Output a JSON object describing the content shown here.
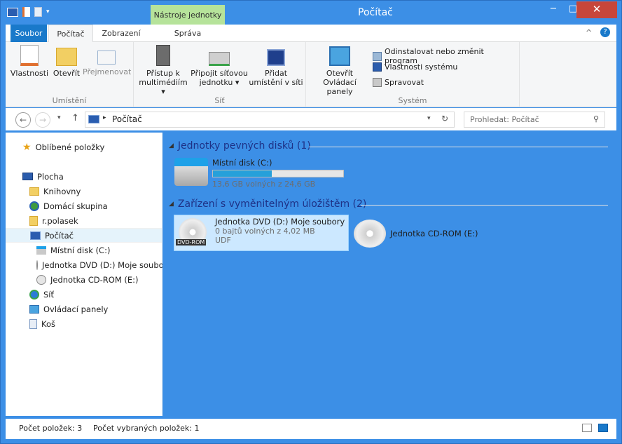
{
  "window": {
    "title": "Počítač",
    "contextual_tab": "Nástroje jednotky",
    "minimize": "−",
    "maximize": "□",
    "close": "✕"
  },
  "tabs": [
    {
      "label": "Soubor"
    },
    {
      "label": "Počítač"
    },
    {
      "label": "Zobrazení"
    },
    {
      "label": "Správa"
    }
  ],
  "ribbon": {
    "groups": [
      {
        "label": "Umístění"
      },
      {
        "label": "Síť"
      },
      {
        "label": "Systém"
      }
    ],
    "properties": "Vlastnosti",
    "open": "Otevřít",
    "rename": "Přejmenovat",
    "media": "Přístup k multimédiím",
    "map_drive": "Připojit síťovou jednotku",
    "add_location": "Přidat umístění v síti",
    "control_panel": "Otevřít Ovládací panely",
    "uninstall": "Odinstalovat nebo změnit program",
    "sys_props": "Vlastnosti systému",
    "manage": "Spravovat"
  },
  "address": {
    "path": "Počítač",
    "search_placeholder": "Prohledat: Počítač"
  },
  "nav": {
    "favorites": "Oblíbené položky",
    "desktop": "Plocha",
    "libraries": "Knihovny",
    "homegroup": "Domácí skupina",
    "user": "r.polasek",
    "computer": "Počítač",
    "disk_c": "Místní disk (C:)",
    "dvd": "Jednotka DVD (D:) Moje soubory",
    "cdrom": "Jednotka CD-ROM (E:)",
    "network": "Síť",
    "control_panel": "Ovládací panely",
    "trash": "Koš"
  },
  "content": {
    "group_hdd": "Jednotky pevných disků (1)",
    "group_removable": "Zařízení s vyměnitelným úložištěm (2)",
    "disk_c": {
      "name": "Místní disk (C:)",
      "free": "13,6 GB volných z 24,6 GB",
      "used_fraction": 0.45
    },
    "dvd": {
      "name": "Jednotka DVD (D:) Moje soubory",
      "free": "0 bajtů volných z 4,02 MB",
      "fs": "UDF",
      "badge": "DVD-ROM"
    },
    "cdrom": {
      "name": "Jednotka CD-ROM (E:)"
    }
  },
  "status": {
    "count": "Počet položek: 3",
    "selected": "Počet vybraných položek: 1"
  },
  "colors": {
    "accent": "#1979ca",
    "frame": "#3c8fe6",
    "contextual": "#b6e39a",
    "selection": "#cce8ff",
    "close": "#c7463a"
  }
}
